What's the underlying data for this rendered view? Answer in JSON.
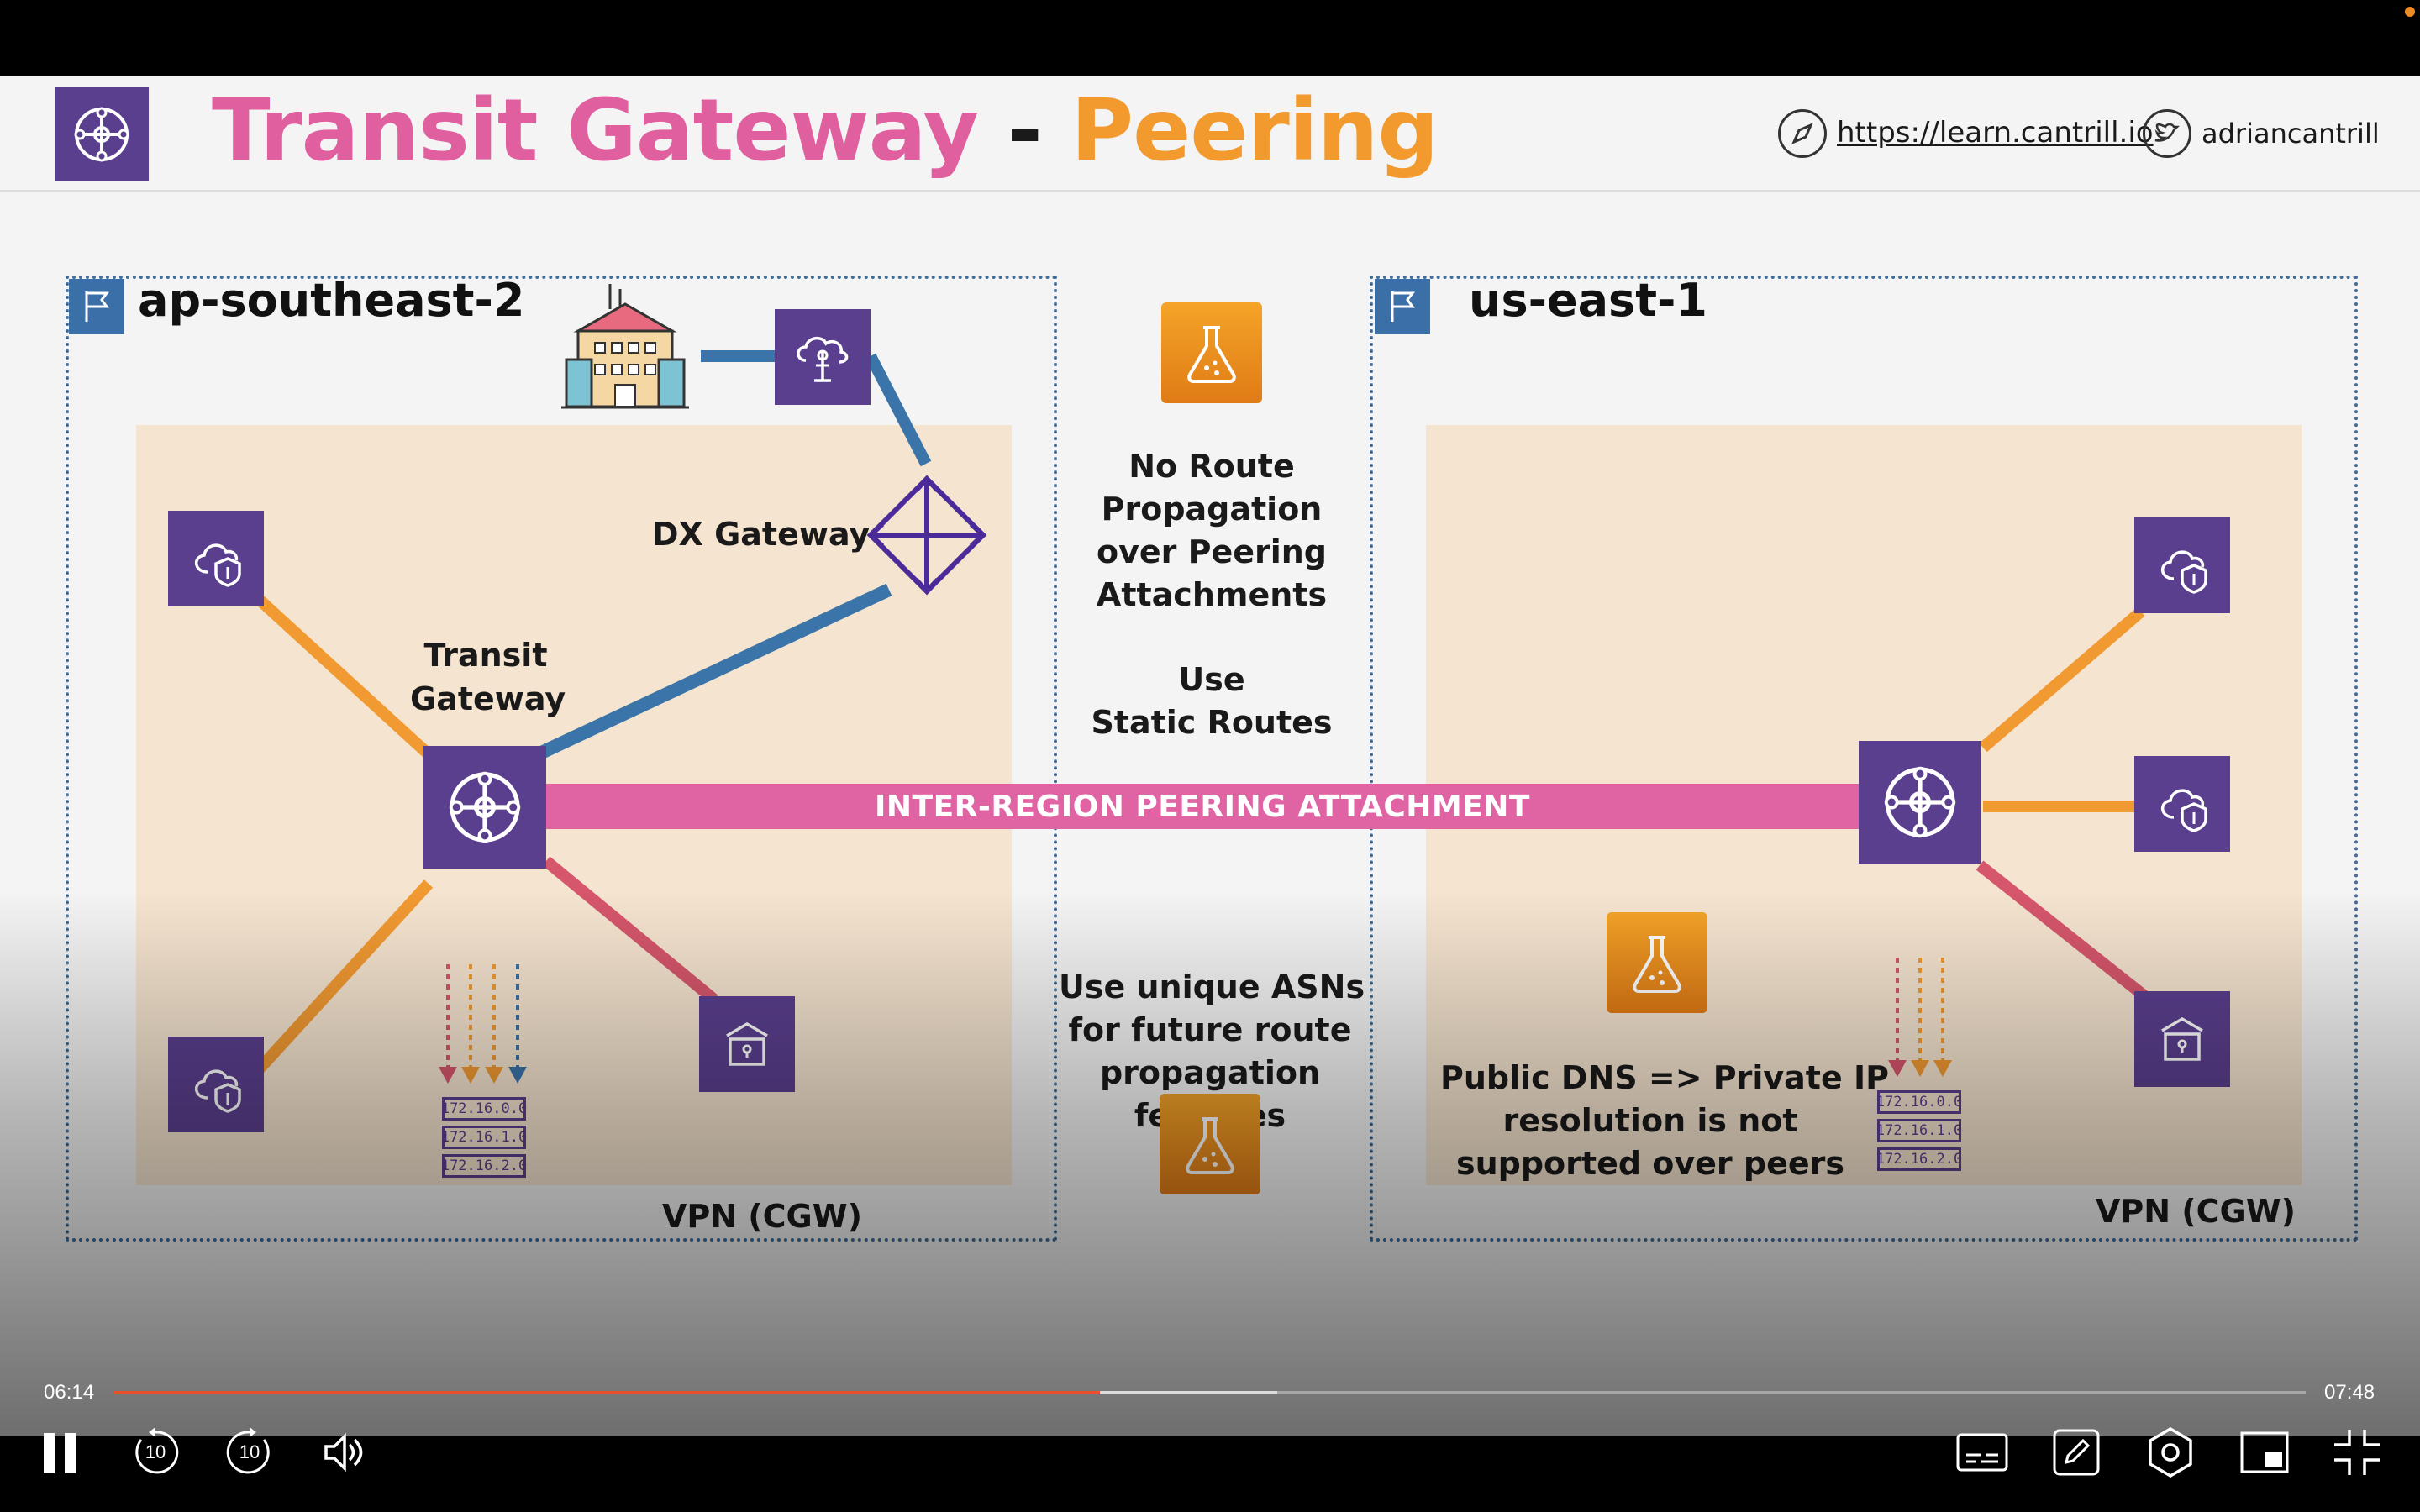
{
  "slide": {
    "title_part1": "Transit Gateway",
    "title_separator": "-",
    "title_part2": "Peering",
    "title_color1": "#e0609f",
    "title_color2": "#f39a2f",
    "website": "https://learn.cantrill.io",
    "twitter": "adriancantrill",
    "left_region": {
      "name": "ap-southeast-2",
      "dx_gateway_label": "DX Gateway",
      "tgw_label_line1": "Transit",
      "tgw_label_line2": "Gateway",
      "vpn_label": "VPN (CGW)",
      "routes": [
        "172.16.0.0",
        "172.16.1.0",
        "172.16.2.0"
      ]
    },
    "right_region": {
      "name": "us-east-1",
      "vpn_label": "VPN (CGW)",
      "dns_note": [
        "Public DNS => Private IP",
        "resolution is not",
        "supported over peers"
      ],
      "routes": [
        "172.16.0.0",
        "172.16.1.0",
        "172.16.2.0"
      ]
    },
    "peering_label": "INTER-REGION PEERING ATTACHMENT",
    "middle_notes": {
      "no_route": [
        "No Route",
        "Propagation",
        "over Peering",
        "Attachments"
      ],
      "static": [
        "Use",
        "Static Routes"
      ],
      "asn": [
        "Use unique ASNs",
        "for future route",
        "propagation",
        "features"
      ]
    },
    "colors": {
      "purple": "#5b3f8f",
      "pink_link": "#e063a4",
      "blue_link": "#3a74a8",
      "orange_link": "#f29a32",
      "red_link": "#d6566c"
    }
  },
  "player": {
    "current_time": "06:14",
    "duration": "07:48",
    "progress_fraction": 0.4498,
    "buffered_fraction": 0.5308,
    "skip_back_label": "10",
    "skip_forward_label": "10",
    "progress_color": "#e8502c"
  }
}
